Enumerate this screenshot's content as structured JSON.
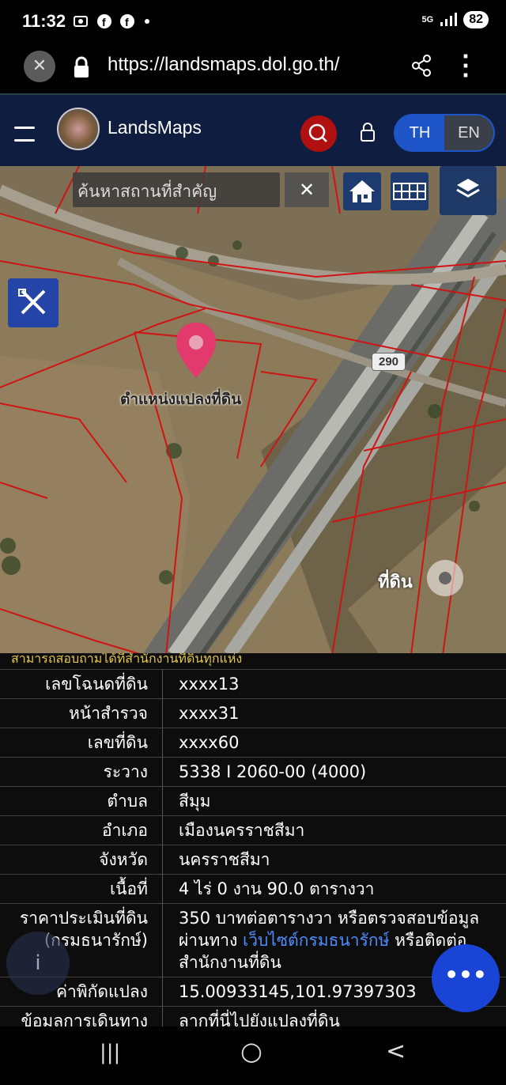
{
  "status_bar": {
    "time": "11:32",
    "network": "5G",
    "battery": "82"
  },
  "browser": {
    "url": "https://landsmaps.dol.go.th/"
  },
  "header": {
    "brand": "LandsMaps",
    "lang_th": "TH",
    "lang_en": "EN"
  },
  "map": {
    "search_placeholder": "ค้นหาสถานที่สำคัญ",
    "clear_glyph": "✕",
    "parcel_label": "ตำแหน่งแปลงที่ดิน",
    "road_sign": "290",
    "land_label": "ที่ดิน"
  },
  "info_panel": {
    "note": "สามารถสอบถามได้ที่สำนักงานที่ดินทุกแห่ง",
    "rows": [
      {
        "label": "เลขโฉนดที่ดิน",
        "value": "xxxx13"
      },
      {
        "label": "หน้าสำรวจ",
        "value": "xxxx31"
      },
      {
        "label": "เลขที่ดิน",
        "value": "xxxx60"
      },
      {
        "label": "ระวาง",
        "value": "5338 I 2060-00 (4000)"
      },
      {
        "label": "ตำบล",
        "value": "สีมุม"
      },
      {
        "label": "อำเภอ",
        "value": "เมืองนครราชสีมา"
      },
      {
        "label": "จังหวัด",
        "value": "นครราชสีมา"
      },
      {
        "label": "เนื้อที่",
        "value": "4 ไร่ 0 งาน 90.0 ตารางวา"
      }
    ],
    "price_label_1": "ราคาประเมินที่ดิน",
    "price_label_2": "(กรมธนารักษ์)",
    "price_value_1": "350 บาทต่อตารางวา หรือตรวจสอบข้อมูล",
    "price_value_2a": "ผ่านทาง ",
    "price_link": "เว็บไซต์กรมธนารักษ์",
    "price_value_2b": " หรือติดต่อ",
    "price_value_3": "สำนักงานที่ดิน",
    "coord_label": "ค่าพิกัดแปลง",
    "coord_value": "15.00933145,101.97397303",
    "directions_label": "ข้อมูลการเดินทาง",
    "directions_value": "ลากที่นี่ไปยังแปลงที่ดิน",
    "info_glyph": "i",
    "fab_glyph": "•••"
  },
  "nav_bar": {
    "recents": "|||",
    "home": "○",
    "back": "<"
  }
}
